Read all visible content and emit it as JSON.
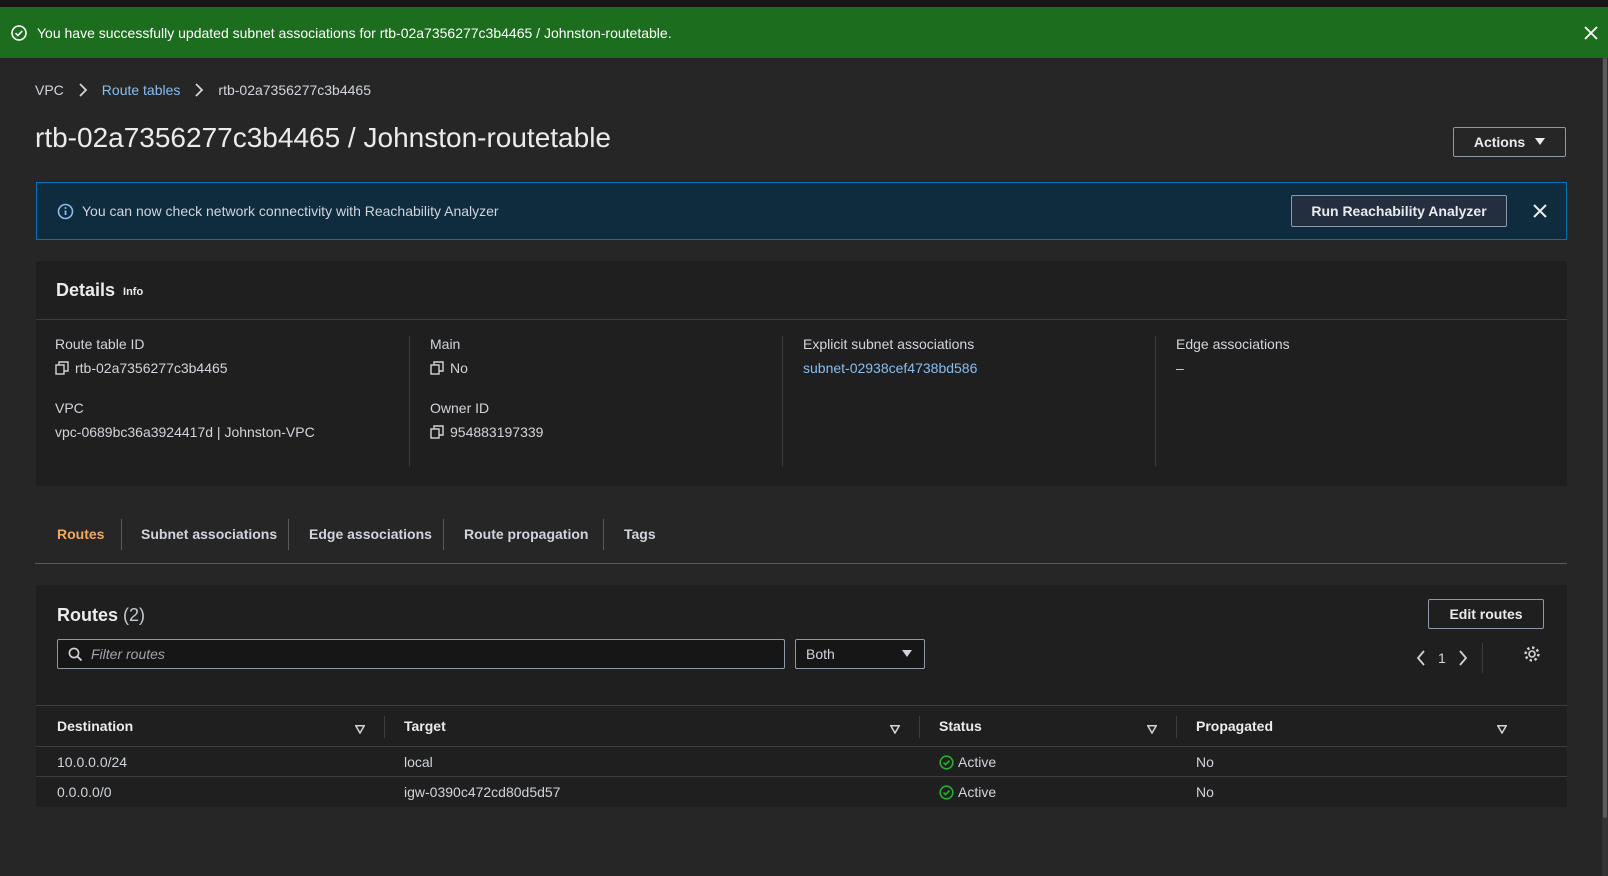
{
  "flash": {
    "message": "You have successfully updated subnet associations for rtb-02a7356277c3b4465 / Johnston-routetable.",
    "bg_color": "#1d6d1f"
  },
  "breadcrumb": [
    "VPC",
    "Route tables",
    "rtb-02a7356277c3b4465"
  ],
  "page_title": "rtb-02a7356277c3b4465 / Johnston-routetable",
  "actions_label": "Actions",
  "info_bar": {
    "message": "You can now check network connectivity with Reachability Analyzer",
    "button": "Run Reachability Analyzer"
  },
  "details": {
    "heading": "Details",
    "info_link": "Info",
    "route_table_id": {
      "label": "Route table ID",
      "value": "rtb-02a7356277c3b4465"
    },
    "vpc": {
      "label": "VPC",
      "value": "vpc-0689bc36a3924417d | Johnston-VPC"
    },
    "main": {
      "label": "Main",
      "value": "No"
    },
    "owner_id": {
      "label": "Owner ID",
      "value": "954883197339"
    },
    "explicit_subnet": {
      "label": "Explicit subnet associations",
      "value": "subnet-02938cef4738bd586"
    },
    "edge": {
      "label": "Edge associations",
      "value": "–"
    }
  },
  "tabs": [
    "Routes",
    "Subnet associations",
    "Edge associations",
    "Route propagation",
    "Tags"
  ],
  "routes": {
    "heading": "Routes",
    "count": "(2)",
    "edit_button": "Edit routes",
    "filter_placeholder": "Filter routes",
    "select_value": "Both",
    "page": "1",
    "columns": [
      "Destination",
      "Target",
      "Status",
      "Propagated"
    ],
    "rows": [
      {
        "destination": "10.0.0.0/24",
        "target": "local",
        "status": "Active",
        "propagated": "No"
      },
      {
        "destination": "0.0.0.0/0",
        "target": "igw-0390c472cd80d5d57",
        "status": "Active",
        "propagated": "No"
      }
    ]
  },
  "colors": {
    "accent": "#f0a960",
    "link": "#89bdee",
    "success": "#29ad32",
    "info_border": "#0073bb"
  }
}
